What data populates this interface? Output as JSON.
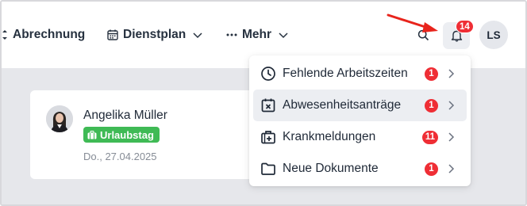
{
  "nav": {
    "abrechnung_label": "Abrechnung",
    "dienstplan_label": "Dienstplan",
    "mehr_label": "Mehr"
  },
  "header": {
    "notifications_count": "14",
    "user_initials": "LS"
  },
  "card": {
    "name": "Angelika Müller",
    "tag_label": "Urlaubstag",
    "date": "Do., 27.04.2025"
  },
  "notifications_menu": {
    "items": [
      {
        "label": "Fehlende Arbeitszeiten",
        "count": "1",
        "icon": "clock-icon"
      },
      {
        "label": "Abwesenheitsanträge",
        "count": "1",
        "icon": "calendar-x-icon"
      },
      {
        "label": "Krankmeldungen",
        "count": "11",
        "icon": "medical-bag-icon"
      },
      {
        "label": "Neue Dokumente",
        "count": "1",
        "icon": "folder-icon"
      }
    ]
  },
  "colors": {
    "badge": "#ef2e35",
    "tag": "#3fba55",
    "arrow": "#e8241c",
    "content_bg": "#e6e7eb"
  }
}
